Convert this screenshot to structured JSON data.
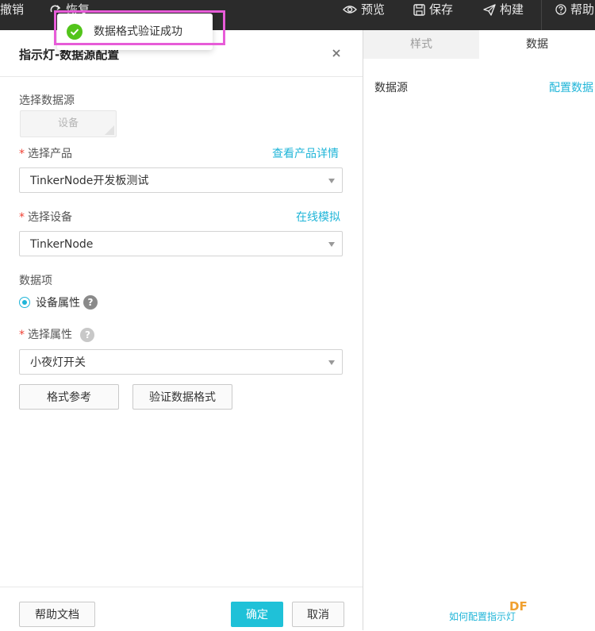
{
  "topbar": {
    "undo_label": "撤销",
    "redo_label": "恢复",
    "preview_label": "预览",
    "save_label": "保存",
    "build_label": "构建",
    "help_label": "帮助"
  },
  "dialog": {
    "title": "指示灯-数据源配置",
    "source_label": "选择数据源",
    "source_option": "设备",
    "product_label": "选择产品",
    "product_link": "查看产品详情",
    "product_value": "TinkerNode开发板测试",
    "device_label": "选择设备",
    "device_link": "在线模拟",
    "device_value": "TinkerNode",
    "data_item_label": "数据项",
    "radio_label": "设备属性",
    "attr_label": "选择属性",
    "attr_value": "小夜灯开关",
    "format_ref_button": "格式参考",
    "verify_button": "验证数据格式",
    "help_doc_button": "帮助文档",
    "ok_button": "确定",
    "cancel_button": "取消"
  },
  "right_panel": {
    "tab_style": "样式",
    "tab_data": "数据",
    "source_label": "数据源",
    "config_link": "配置数据",
    "bottom_link": "如何配置指示灯"
  },
  "toast": {
    "message": "数据格式验证成功"
  },
  "watermark": "DF",
  "colors": {
    "accent": "#1fb5d8",
    "primary_button": "#1fc1d8",
    "required": "#f04134",
    "success": "#52c41a",
    "highlight": "#e75cd8",
    "topbar": "#2b2b2b"
  }
}
